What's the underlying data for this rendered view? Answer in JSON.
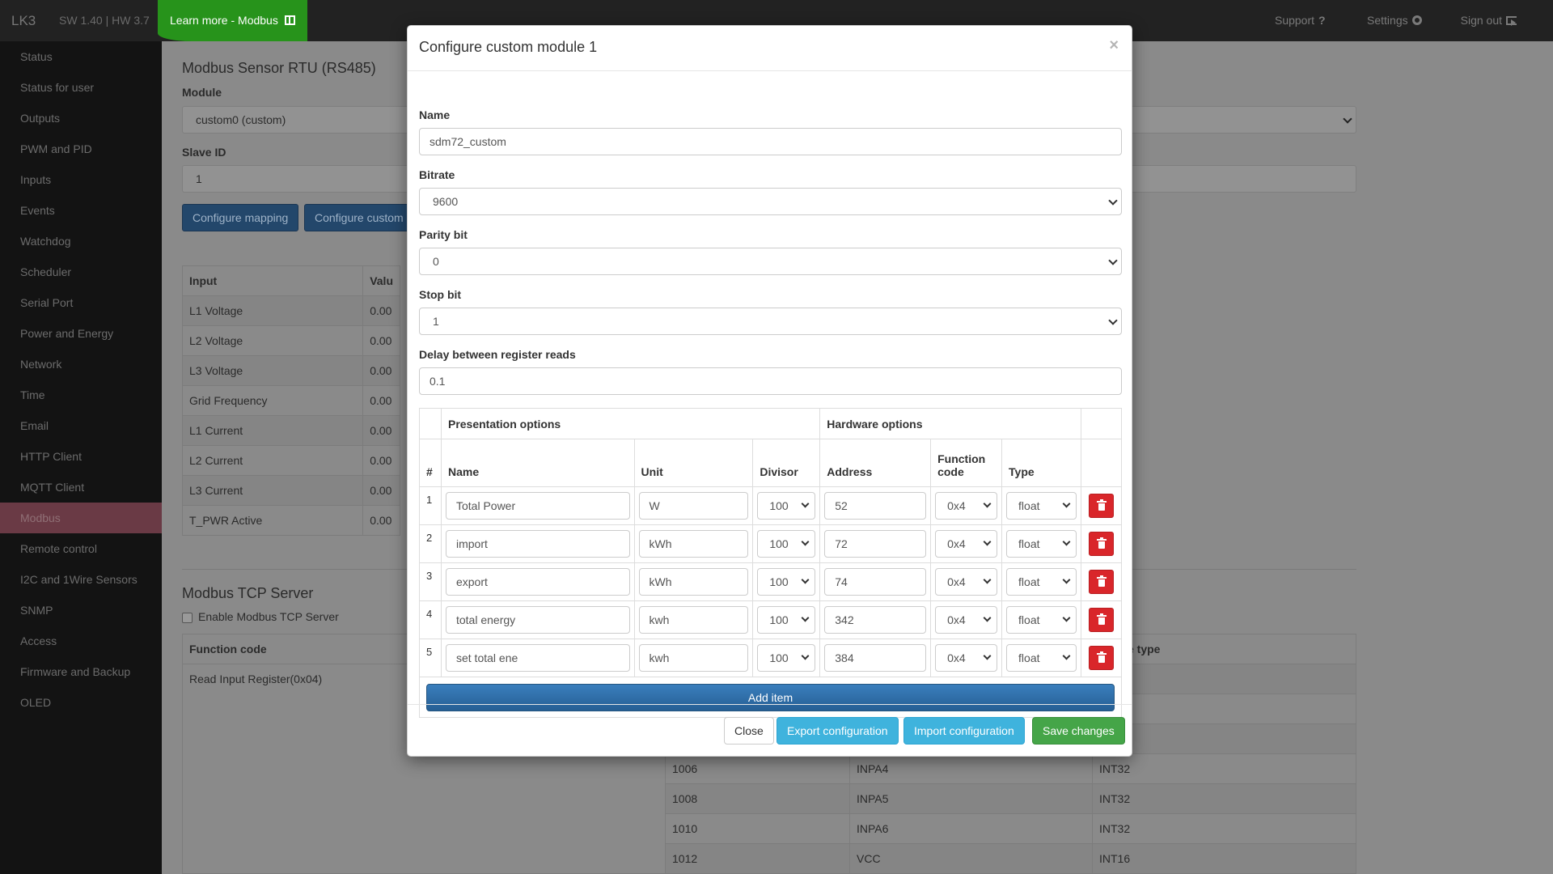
{
  "topbar": {
    "brand": "LK3",
    "version": "SW 1.40 | HW 3.7",
    "learn_more": "Learn more - Modbus",
    "support": "Support",
    "settings": "Settings",
    "sign_out": "Sign out"
  },
  "sidebar": {
    "items": [
      {
        "label": "Status"
      },
      {
        "label": "Status for user"
      },
      {
        "label": "Outputs"
      },
      {
        "label": "PWM and PID"
      },
      {
        "label": "Inputs"
      },
      {
        "label": "Events"
      },
      {
        "label": "Watchdog"
      },
      {
        "label": "Scheduler"
      },
      {
        "label": "Serial Port"
      },
      {
        "label": "Power and Energy"
      },
      {
        "label": "Network"
      },
      {
        "label": "Time"
      },
      {
        "label": "Email"
      },
      {
        "label": "HTTP Client"
      },
      {
        "label": "MQTT Client"
      },
      {
        "label": "Modbus"
      },
      {
        "label": "Remote control"
      },
      {
        "label": "I2C and 1Wire Sensors"
      },
      {
        "label": "SNMP"
      },
      {
        "label": "Access"
      },
      {
        "label": "Firmware and Backup"
      },
      {
        "label": "OLED"
      }
    ],
    "active": "Modbus"
  },
  "page": {
    "rtu_title": "Modbus Sensor RTU (RS485)",
    "module_label": "Module",
    "module_value": "custom0 (custom)",
    "slave_label": "Slave ID",
    "slave_value": "1",
    "btn_mapping": "Configure mapping",
    "btn_custom": "Configure custom",
    "input_table": {
      "headers": [
        "Input",
        "Valu"
      ],
      "rows": [
        [
          "L1 Voltage",
          "0.00"
        ],
        [
          "L2 Voltage",
          "0.00"
        ],
        [
          "L3 Voltage",
          "0.00"
        ],
        [
          "Grid Frequency",
          "0.00"
        ],
        [
          "L1 Current",
          "0.00"
        ],
        [
          "L2 Current",
          "0.00"
        ],
        [
          "L3 Current",
          "0.00"
        ],
        [
          "T_PWR Active",
          "0.00"
        ]
      ]
    },
    "tcp_title": "Modbus TCP Server",
    "tcp_enable": "Enable Modbus TCP Server",
    "fc_header": "Function code",
    "fc_value": "Read Input Register(0x04)",
    "type_header_fragment": "e type",
    "reg_rows": [
      [
        "1006",
        "INPA4",
        "INT32"
      ],
      [
        "1008",
        "INPA5",
        "INT32"
      ],
      [
        "1010",
        "INPA6",
        "INT32"
      ],
      [
        "1012",
        "VCC",
        "INT16"
      ]
    ]
  },
  "modal": {
    "title": "Configure custom module 1",
    "close_glyph": "×",
    "name_label": "Name",
    "name_value": "sdm72_custom",
    "bitrate_label": "Bitrate",
    "bitrate_value": "9600",
    "parity_label": "Parity bit",
    "parity_value": "0",
    "stop_label": "Stop bit",
    "stop_value": "1",
    "delay_label": "Delay between register reads",
    "delay_value": "0.1",
    "table": {
      "group_presentation": "Presentation options",
      "group_hardware": "Hardware options",
      "col_num": "#",
      "col_name": "Name",
      "col_unit": "Unit",
      "col_divisor": "Divisor",
      "col_address": "Address",
      "col_function_l1": "Function",
      "col_function_l2": "code",
      "col_type": "Type",
      "rows": [
        {
          "num": "1",
          "name": "Total Power",
          "unit": "W",
          "divisor": "100",
          "address": "52",
          "function": "0x4",
          "type": "float"
        },
        {
          "num": "2",
          "name": "import",
          "unit": "kWh",
          "divisor": "100",
          "address": "72",
          "function": "0x4",
          "type": "float"
        },
        {
          "num": "3",
          "name": "export",
          "unit": "kWh",
          "divisor": "100",
          "address": "74",
          "function": "0x4",
          "type": "float"
        },
        {
          "num": "4",
          "name": "total energy",
          "unit": "kwh",
          "divisor": "100",
          "address": "342",
          "function": "0x4",
          "type": "float"
        },
        {
          "num": "5",
          "name": "set total ene",
          "unit": "kwh",
          "divisor": "100",
          "address": "384",
          "function": "0x4",
          "type": "float"
        }
      ],
      "add_item": "Add item"
    },
    "footer": {
      "close": "Close",
      "export": "Export configuration",
      "import": "Import configuration",
      "save": "Save changes"
    }
  },
  "colors": {
    "learn_more_bg": "#27931b",
    "active_sidebar": "#6a3a45",
    "delete_red": "#d9262a",
    "add_blue": "#2c6da4",
    "info_blue": "#3fb3dd",
    "save_green": "#45a548"
  },
  "icons": {
    "support": "question-icon",
    "settings": "gear-icon",
    "sign_out": "sign-out-icon",
    "learn_more": "book-icon",
    "delete": "trash-icon"
  }
}
